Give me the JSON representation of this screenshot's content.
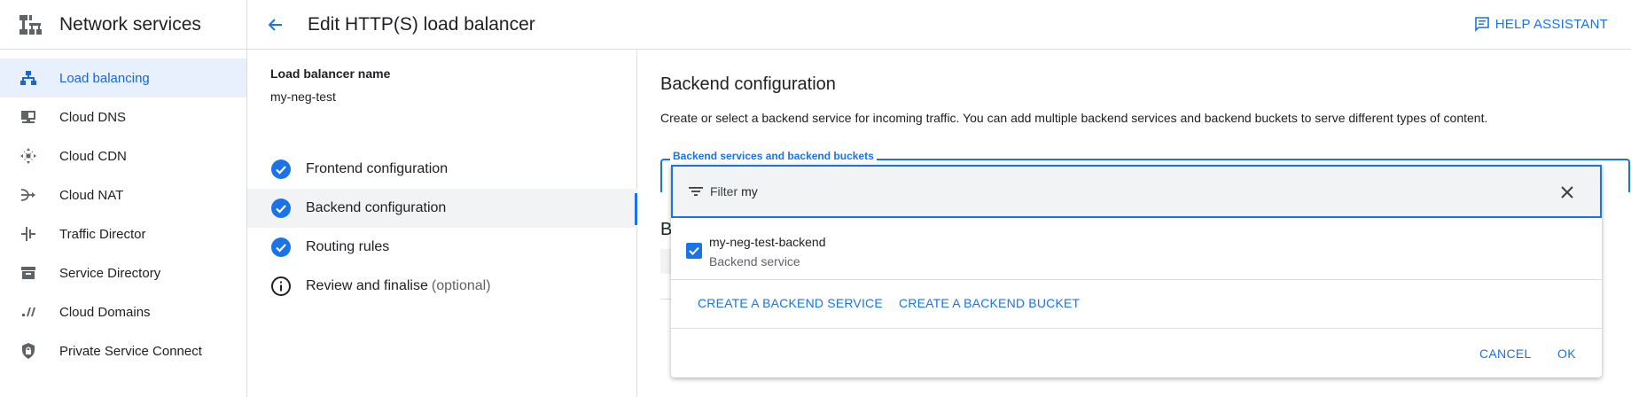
{
  "nav": {
    "title": "Network services",
    "items": [
      {
        "label": "Load balancing",
        "icon": "load-balancing-icon",
        "active": true
      },
      {
        "label": "Cloud DNS",
        "icon": "dns-icon"
      },
      {
        "label": "Cloud CDN",
        "icon": "cdn-icon"
      },
      {
        "label": "Cloud NAT",
        "icon": "nat-icon"
      },
      {
        "label": "Traffic Director",
        "icon": "traffic-director-icon"
      },
      {
        "label": "Service Directory",
        "icon": "service-directory-icon"
      },
      {
        "label": "Cloud Domains",
        "icon": "domains-icon"
      },
      {
        "label": "Private Service Connect",
        "icon": "shield-lock-icon"
      }
    ]
  },
  "header": {
    "title": "Edit HTTP(S) load balancer",
    "help_label": "HELP ASSISTANT"
  },
  "lb": {
    "name_label": "Load balancer name",
    "name_value": "my-neg-test"
  },
  "steps": [
    {
      "label": "Frontend configuration",
      "status": "done"
    },
    {
      "label": "Backend configuration",
      "status": "done",
      "active": true
    },
    {
      "label": "Routing rules",
      "status": "done"
    },
    {
      "label": "Review and finalise",
      "optional": "(optional)",
      "status": "info"
    }
  ],
  "backend": {
    "title": "Backend configuration",
    "description": "Create or select a backend service for incoming traffic. You can add multiple backend services and backend buckets to serve different types of content.",
    "field_label": "Backend services and backend buckets",
    "hidden_heading_initial": "B"
  },
  "dropdown": {
    "filter_label": "Filter",
    "filter_value": "my",
    "option_name": "my-neg-test-backend",
    "option_type": "Backend service",
    "option_checked": true,
    "create_service": "CREATE A BACKEND SERVICE",
    "create_bucket": "CREATE A BACKEND BUCKET",
    "cancel": "CANCEL",
    "ok": "OK"
  },
  "colors": {
    "accent": "#1a73e8",
    "active_bg": "#e8f0fe"
  }
}
